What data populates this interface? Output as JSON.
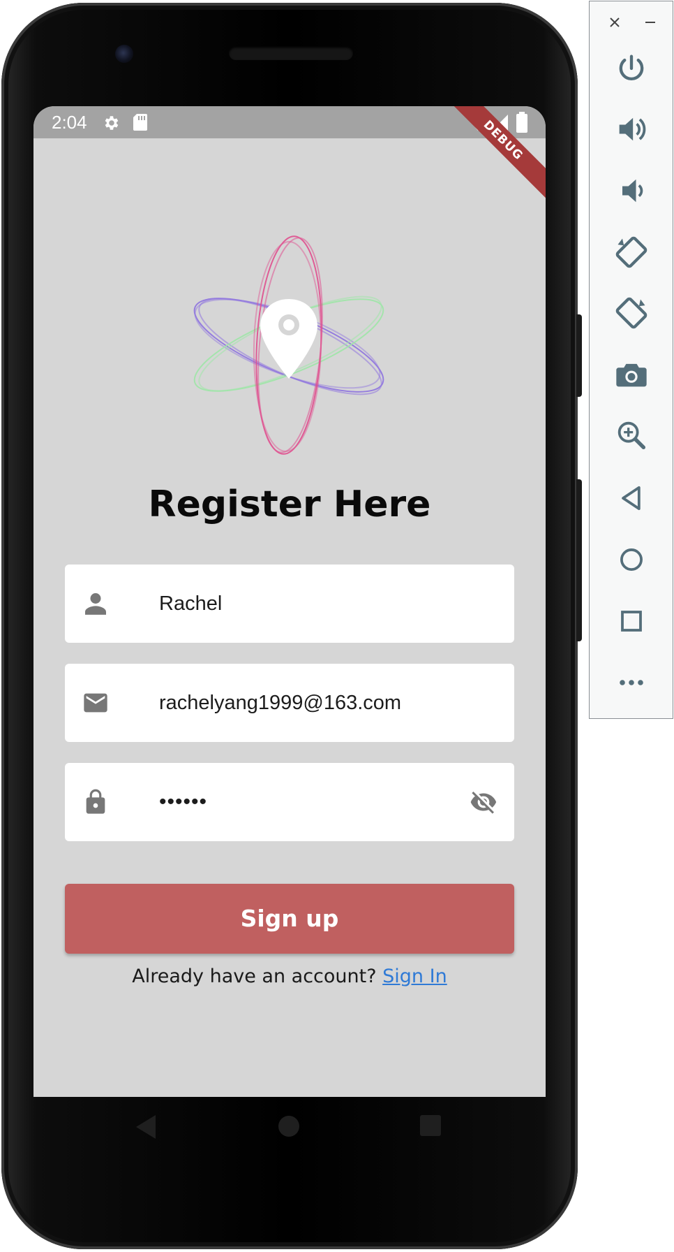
{
  "status_bar": {
    "time": "2:04",
    "icons": [
      "settings-icon",
      "sd-card-icon",
      "wifi-icon",
      "signal-icon",
      "battery-icon"
    ],
    "debug_banner": "DEBUG"
  },
  "page": {
    "title": "Register Here",
    "logo_icon": "location-pin-atom-logo"
  },
  "form": {
    "name": {
      "value": "Rachel",
      "icon": "person-icon"
    },
    "email": {
      "value": "rachelyang1999@163.com",
      "icon": "mail-icon"
    },
    "password": {
      "value": "••••••",
      "icon": "lock-icon",
      "toggle_icon": "eye-off-icon"
    },
    "signup_label": "Sign up",
    "signin_prompt": "Already have an account? ",
    "signin_link": "Sign In"
  },
  "nav_bar": [
    "back-icon",
    "home-icon",
    "recents-icon"
  ],
  "emulator_toolbar": {
    "window_controls": [
      "close-icon",
      "minimize-icon"
    ],
    "buttons": [
      "power-icon",
      "volume-up-icon",
      "volume-down-icon",
      "rotate-left-icon",
      "rotate-right-icon",
      "camera-icon",
      "zoom-icon",
      "back-icon",
      "home-icon",
      "overview-icon",
      "more-icon"
    ]
  },
  "colors": {
    "screen_bg": "#d6d6d6",
    "status_bar": "#a3a3a3",
    "accent_button": "#c06060",
    "link": "#2f7ad6",
    "debug_ribbon": "#a53a3a",
    "toolbar_icon": "#546e7a"
  }
}
